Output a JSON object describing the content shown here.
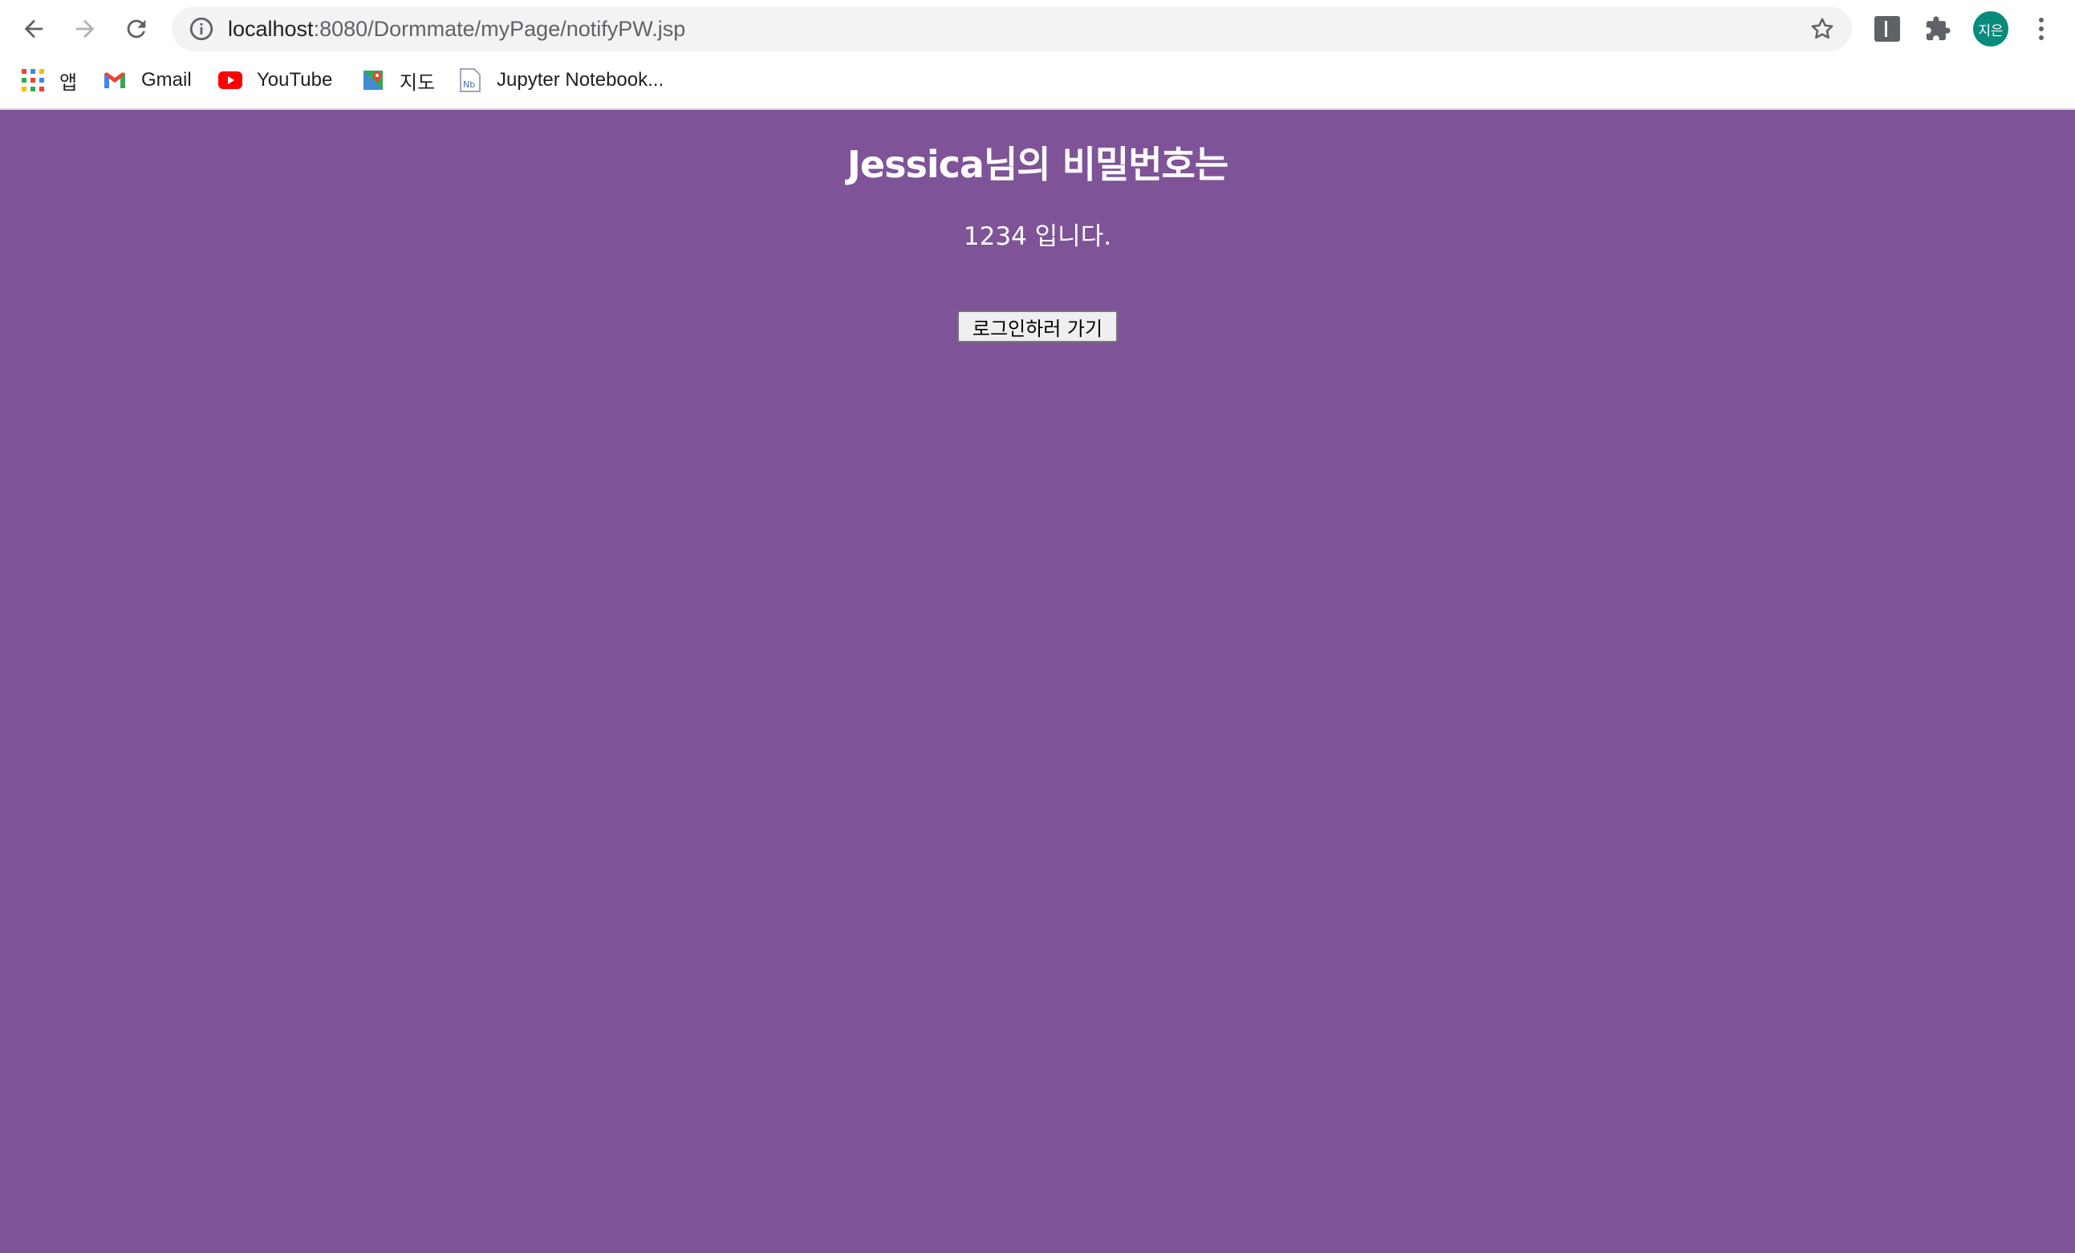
{
  "browser": {
    "url_host": "localhost",
    "url_rest": ":8080/Dormmate/myPage/notifyPW.jsp",
    "profile_initials": "지은",
    "bookmarks": [
      {
        "label": "앱",
        "icon": "apps-grid-icon"
      },
      {
        "label": "Gmail",
        "icon": "gmail-icon"
      },
      {
        "label": "YouTube",
        "icon": "youtube-icon"
      },
      {
        "label": "지도",
        "icon": "maps-icon"
      },
      {
        "label": "Jupyter Notebook...",
        "icon": "notebook-icon"
      }
    ],
    "colors": {
      "page_background": "#7f5398",
      "avatar": "#0a8a7a"
    }
  },
  "page": {
    "title": "Jessica님의 비밀번호는",
    "message": "1234 입니다.",
    "login_button_label": "로그인하러 가기"
  }
}
